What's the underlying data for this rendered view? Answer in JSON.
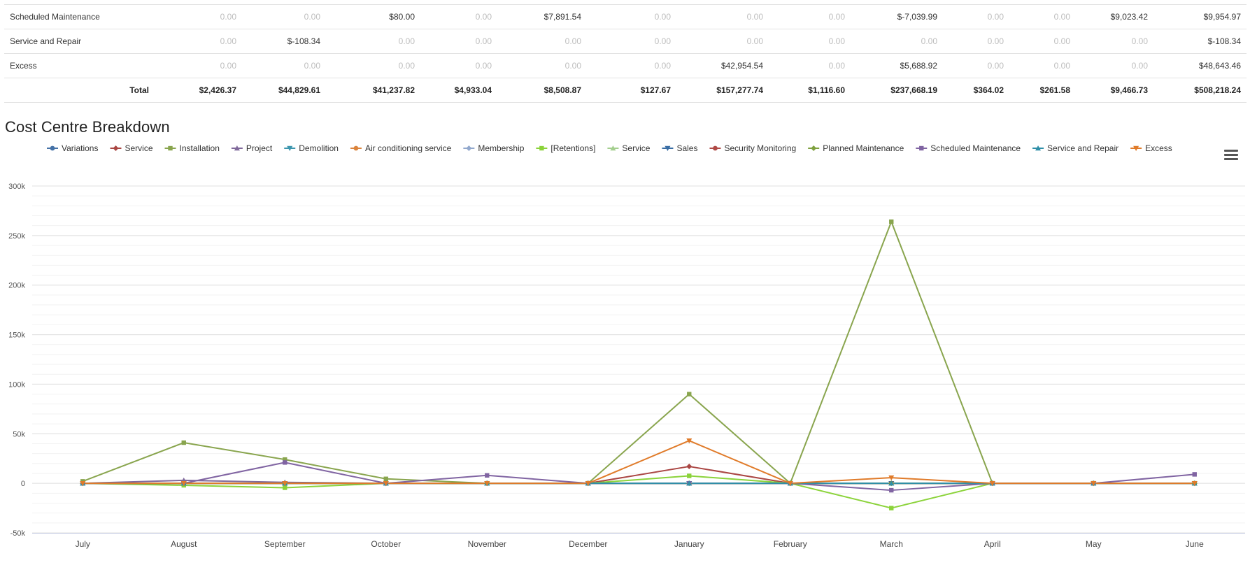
{
  "table": {
    "rows": [
      {
        "name": "Scheduled Maintenance",
        "values": [
          "0.00",
          "0.00",
          "$80.00",
          "0.00",
          "$7,891.54",
          "0.00",
          "0.00",
          "0.00",
          "$-7,039.99",
          "0.00",
          "0.00",
          "$9,023.42",
          "$9,954.97"
        ]
      },
      {
        "name": "Service and Repair",
        "values": [
          "0.00",
          "$-108.34",
          "0.00",
          "0.00",
          "0.00",
          "0.00",
          "0.00",
          "0.00",
          "0.00",
          "0.00",
          "0.00",
          "0.00",
          "$-108.34"
        ]
      },
      {
        "name": "Excess",
        "values": [
          "0.00",
          "0.00",
          "0.00",
          "0.00",
          "0.00",
          "0.00",
          "$42,954.54",
          "0.00",
          "$5,688.92",
          "0.00",
          "0.00",
          "0.00",
          "$48,643.46"
        ]
      }
    ],
    "total": {
      "label": "Total",
      "values": [
        "$2,426.37",
        "$44,829.61",
        "$41,237.82",
        "$4,933.04",
        "$8,508.87",
        "$127.67",
        "$157,277.74",
        "$1,116.60",
        "$237,668.19",
        "$364.02",
        "$261.58",
        "$9,466.73",
        "$508,218.24"
      ]
    }
  },
  "chart_title": "Cost Centre Breakdown",
  "menu_icon": "hamburger-menu-icon",
  "chart_data": {
    "type": "line",
    "x": [
      "July",
      "August",
      "September",
      "October",
      "November",
      "December",
      "January",
      "February",
      "March",
      "April",
      "May",
      "June"
    ],
    "ylim": [
      -50000,
      300000
    ],
    "yticks": [
      -50000,
      0,
      50000,
      100000,
      150000,
      200000,
      250000,
      300000
    ],
    "ytick_labels": [
      "-50k",
      "0",
      "50k",
      "100k",
      "150k",
      "200k",
      "250k",
      "300k"
    ],
    "grid": true,
    "legend_position": "top",
    "series": [
      {
        "name": "Variations",
        "color": "#4572a7",
        "marker": "circle",
        "values": [
          0,
          0,
          0,
          0,
          0,
          0,
          0,
          0,
          0,
          0,
          0,
          0
        ]
      },
      {
        "name": "Service",
        "color": "#aa4643",
        "marker": "diamond",
        "values": [
          0,
          0,
          0,
          0,
          0,
          0,
          17000,
          0,
          0,
          0,
          0,
          0
        ]
      },
      {
        "name": "Installation",
        "color": "#89a54e",
        "marker": "square",
        "values": [
          2000,
          41000,
          24000,
          4500,
          0,
          0,
          90000,
          0,
          264000,
          0,
          0,
          0
        ]
      },
      {
        "name": "Project",
        "color": "#80699b",
        "marker": "triangle",
        "values": [
          0,
          3000,
          1000,
          0,
          0,
          0,
          0,
          0,
          0,
          0,
          0,
          0
        ]
      },
      {
        "name": "Demolition",
        "color": "#3d96ae",
        "marker": "triangle-down",
        "values": [
          0,
          0,
          0,
          0,
          0,
          0,
          0,
          0,
          0,
          0,
          0,
          0
        ]
      },
      {
        "name": "Air conditioning service",
        "color": "#db843d",
        "marker": "circle",
        "values": [
          0,
          0,
          0,
          0,
          0,
          0,
          0,
          0,
          0,
          0,
          0,
          0
        ]
      },
      {
        "name": "Membership",
        "color": "#92a8cd",
        "marker": "diamond",
        "values": [
          0,
          0,
          0,
          0,
          0,
          0,
          0,
          0,
          0,
          0,
          0,
          0
        ]
      },
      {
        "name": "[Retentions]",
        "color": "#8bd33a",
        "marker": "square",
        "values": [
          0,
          -2000,
          -4500,
          0,
          0,
          0,
          7500,
          0,
          -25000,
          0,
          0,
          0
        ]
      },
      {
        "name": "Service",
        "color": "#a4cf8f",
        "marker": "triangle",
        "values": [
          0,
          0,
          0,
          0,
          0,
          0,
          0,
          0,
          0,
          0,
          0,
          0
        ]
      },
      {
        "name": "Sales",
        "color": "#3a6ea5",
        "marker": "triangle-down",
        "values": [
          0,
          0,
          0,
          0,
          0,
          0,
          0,
          0,
          0,
          0,
          0,
          0
        ]
      },
      {
        "name": "Security Monitoring",
        "color": "#b04a46",
        "marker": "circle",
        "values": [
          0,
          0,
          0,
          0,
          0,
          0,
          0,
          0,
          0,
          0,
          0,
          0
        ]
      },
      {
        "name": "Planned Maintenance",
        "color": "#7fa13f",
        "marker": "diamond",
        "values": [
          0,
          0,
          0,
          0,
          0,
          0,
          0,
          0,
          0,
          0,
          0,
          0
        ]
      },
      {
        "name": "Scheduled Maintenance",
        "color": "#8064a2",
        "marker": "square",
        "values": [
          0,
          0,
          21000,
          0,
          8000,
          0,
          0,
          0,
          -7000,
          0,
          0,
          9000
        ]
      },
      {
        "name": "Service and Repair",
        "color": "#2f8fa8",
        "marker": "triangle",
        "values": [
          0,
          0,
          0,
          0,
          0,
          0,
          0,
          0,
          0,
          0,
          0,
          0
        ]
      },
      {
        "name": "Excess",
        "color": "#e07b2a",
        "marker": "triangle-down",
        "values": [
          0,
          0,
          0,
          0,
          0,
          0,
          43000,
          0,
          5700,
          0,
          0,
          0
        ]
      }
    ]
  }
}
